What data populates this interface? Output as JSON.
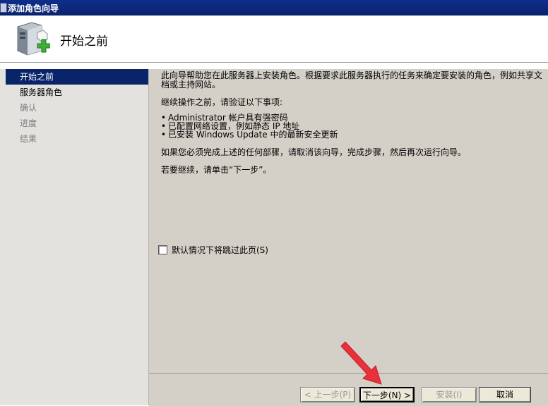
{
  "window": {
    "title": "添加角色向导"
  },
  "header": {
    "title": "开始之前"
  },
  "nav": {
    "items": [
      {
        "label": "开始之前"
      },
      {
        "label": "服务器角色"
      },
      {
        "label": "确认"
      },
      {
        "label": "进度"
      },
      {
        "label": "结果"
      }
    ]
  },
  "content": {
    "intro": "此向导帮助您在此服务器上安装角色。根据要求此服务器执行的任务来确定要安装的角色，例如共享文档或主持网站。",
    "prerequisites_title": "继续操作之前，请验证以下事项:",
    "bullets": [
      "Administrator 帐户具有强密码",
      "已配置网络设置，例如静态 IP 地址",
      "已安装 Windows Update 中的最新安全更新"
    ],
    "fix_note": "如果您必须完成上述的任何部骤，请取消该向导，完成步骤，然后再次运行向导。",
    "continue_note": "若要继续，请单击“下一步”。",
    "skip_checkbox_label": "默认情况下将跳过此页(S)",
    "skip_checked": false
  },
  "buttons": {
    "prev": "< 上一步(P)",
    "next": "下一步(N) >",
    "install": "安装(I)",
    "cancel": "取消"
  },
  "colors": {
    "titlebar": "#0a236e",
    "nav_active": "#0a246a",
    "annotation_arrow": "#e8313b"
  }
}
